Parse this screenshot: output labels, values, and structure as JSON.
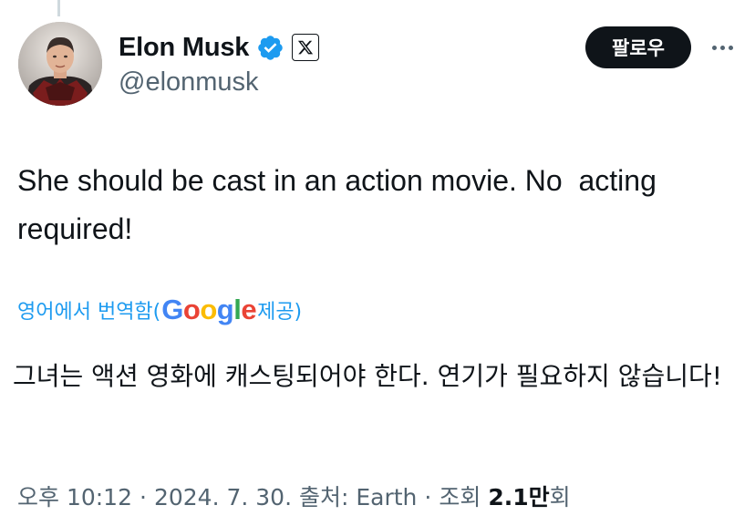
{
  "author": {
    "display_name": "Elon Musk",
    "handle": "@elonmusk",
    "verified_icon": "verified-badge-icon",
    "affiliation_icon": "x-logo-icon"
  },
  "actions": {
    "follow_label": "팔로우",
    "more_icon": "more-options-icon"
  },
  "tweet": {
    "text": "She should be cast in an action movie. No  acting required!"
  },
  "translation": {
    "prefix": "영어에서 번역함(",
    "provider_letters": [
      "G",
      "o",
      "o",
      "g",
      "l",
      "e"
    ],
    "suffix": " 제공)",
    "text": "그녀는 액션 영화에 캐스팅되어야 한다. 연기가 필요하지 않습니다!"
  },
  "meta": {
    "time": "오후 10:12",
    "date": "2024. 7. 30.",
    "source": "출처: Earth",
    "views_prefix": "조회",
    "views_count": "2.1만",
    "views_suffix": "회"
  },
  "colors": {
    "accent": "#1d9bf0",
    "text": "#0f1419",
    "muted": "#536471",
    "button": "#0f1419"
  }
}
